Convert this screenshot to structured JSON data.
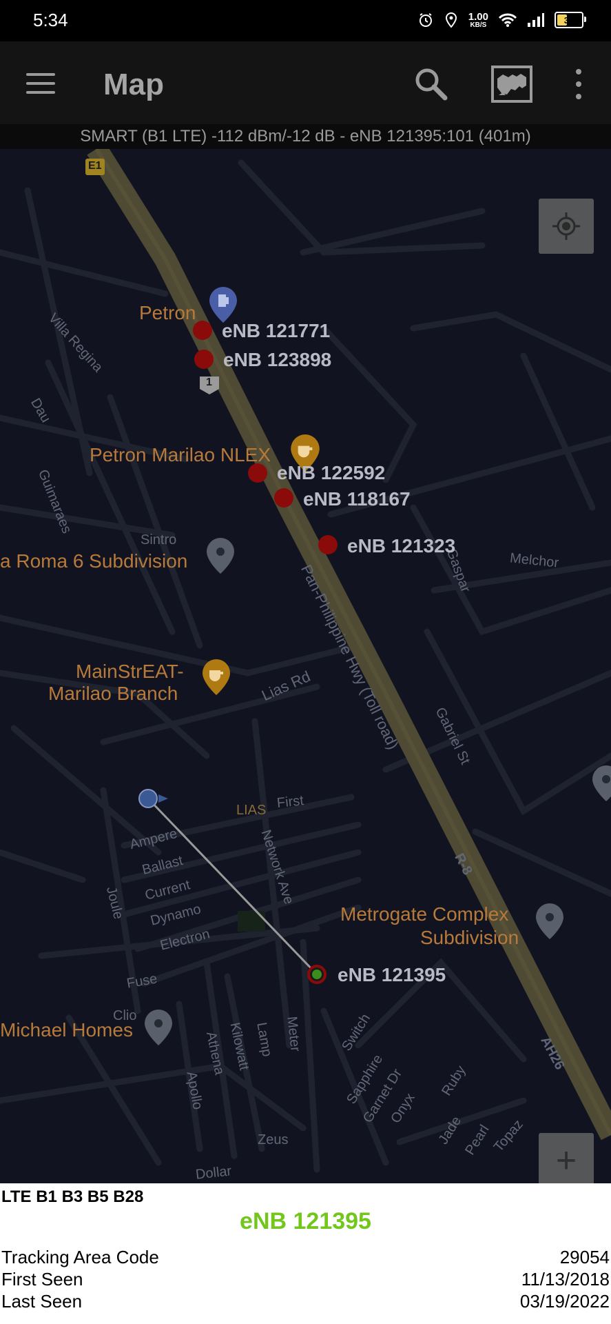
{
  "status_bar": {
    "time": "5:34",
    "net_speed_value": "1.00",
    "net_speed_unit": "KB/S",
    "battery_level": "39",
    "icons": [
      "alarm-icon",
      "location-icon",
      "wifi-icon",
      "cell-signal-icon",
      "battery-icon"
    ]
  },
  "app_bar": {
    "title": "Map",
    "icons": [
      "menu-icon",
      "search-icon",
      "map-layer-icon",
      "overflow-menu-icon"
    ]
  },
  "signal_info": "SMART (B1 LTE) -112 dBm/-12 dB - eNB 121395:101 (401m)",
  "map": {
    "road_shields": [
      "E1",
      "1"
    ],
    "pois": [
      {
        "name": "Petron",
        "icon": "gas-station-icon"
      },
      {
        "name": "Petron Marilao NLEX",
        "icon": "cafe-icon"
      },
      {
        "name": "a Roma 6 Subdivision",
        "icon": "place-pin-icon"
      },
      {
        "name": "MainStrEAT-",
        "name2": "Marilao Branch",
        "icon": "cafe-icon"
      },
      {
        "name": "Metrogate Complex",
        "name2": "Subdivision",
        "icon": "place-pin-icon"
      },
      {
        "name": "Michael Homes",
        "icon": "place-pin-icon"
      }
    ],
    "streets": [
      "Villa Regina",
      "Dau",
      "Guimaraes",
      "Sintro",
      "Melchor",
      "Gaspar",
      "Pan-Philippine Hwy (Toll road)",
      "Lias Rd",
      "Gabriel St",
      "First",
      "LIAS",
      "Ampere",
      "Ballast",
      "Current",
      "Dynamo",
      "Electron",
      "Joule",
      "Network Ave",
      "R-8",
      "Fuse",
      "Clio",
      "Athena",
      "Kilowatt",
      "Lamp",
      "Meter",
      "Switch",
      "Sapphire",
      "Garnet Dr",
      "Onyx",
      "Ruby",
      "Jade",
      "Pearl",
      "Topaz",
      "AH26",
      "Apollo",
      "Zeus",
      "Dollar"
    ],
    "enb_markers": [
      "eNB 121771",
      "eNB 123898",
      "eNB 122592",
      "eNB 118167",
      "eNB 121323"
    ],
    "serving_enb": "eNB 121395",
    "controls": {
      "locate": "my-location-icon",
      "zoom_in": "+"
    }
  },
  "info_panel": {
    "bands": "LTE  B1 B3 B5 B28",
    "enb": "eNB 121395",
    "rows": [
      {
        "label": "Tracking Area Code",
        "value": "29054"
      },
      {
        "label": "First Seen",
        "value": "11/13/2018"
      },
      {
        "label": "Last Seen",
        "value": "03/19/2022"
      }
    ]
  },
  "colors": {
    "map_bg": "#111420",
    "highway": "#4f4a33",
    "enb_marker": "#8b0a0a",
    "serving_enb_highlight": "#72c61c",
    "poi_label": "#b77a3a",
    "appbar_bg": "#141414"
  }
}
